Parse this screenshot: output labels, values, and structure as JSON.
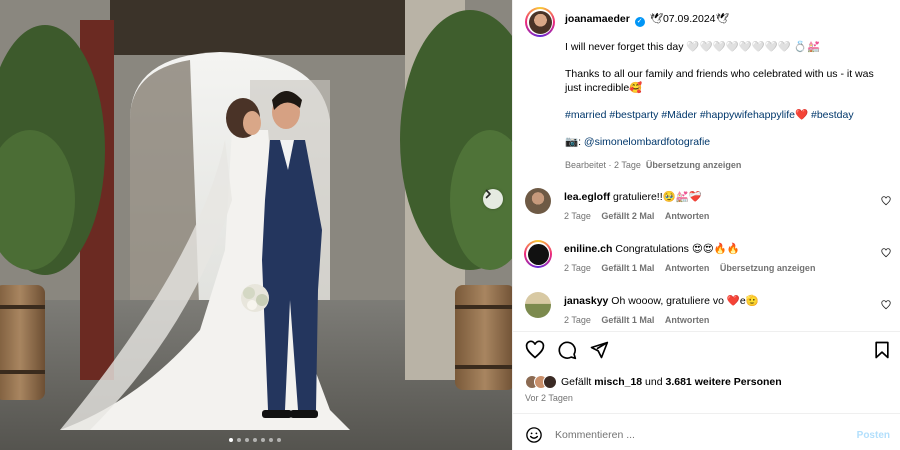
{
  "post": {
    "username": "joanamaeder",
    "date_text": "🕊07.09.2024🕊",
    "caption_line1": "I will never forget this day 🤍🤍🤍🤍🤍🤍🤍🤍 💍💒",
    "caption_line2": "Thanks to all our family and friends who celebrated with us - it was just incredible🥰",
    "hashtags": [
      "#married",
      "#bestparty",
      "#Mäder",
      "#happywifehappylife❤️",
      "#bestday"
    ],
    "photo_credit_icon": "📷:",
    "photo_credit": "@simonelombardfotografie",
    "meta_edited": "Bearbeitet · 2 Tage",
    "meta_translate": "Übersetzung anzeigen"
  },
  "comments": [
    {
      "username": "lea.egloff",
      "text": "gratuliere!!🥹💒❤️‍🩹",
      "time": "2 Tage",
      "likes": "Gefällt 2 Mal",
      "reply": "Antworten",
      "translate": ""
    },
    {
      "username": "eniline.ch",
      "text": "Congratulations 😍😍🔥🔥",
      "time": "2 Tage",
      "likes": "Gefällt 1 Mal",
      "reply": "Antworten",
      "translate": "Übersetzung anzeigen"
    },
    {
      "username": "janaskyy",
      "text": "Oh wooow, gratuliere vo ❤️e🫡",
      "time": "2 Tage",
      "likes": "Gefällt 1 Mal",
      "reply": "Antworten",
      "translate": ""
    }
  ],
  "likes": {
    "prefix": "Gefällt ",
    "user": "misch_18",
    "middle": " und ",
    "count": "3.681 weitere Personen"
  },
  "time_ago": "Vor 2 Tagen",
  "comment_box": {
    "placeholder": "Kommentieren ...",
    "post_label": "Posten"
  },
  "carousel": {
    "slides": 7,
    "active_index": 0
  },
  "icons": {
    "next": "chevron-right-icon",
    "like": "heart-icon",
    "comment": "comment-icon",
    "share": "share-icon",
    "save": "bookmark-icon",
    "emoji": "smiley-icon",
    "comment_like": "heart-icon",
    "verified": "verified-badge-icon"
  },
  "colors": {
    "link": "#00376b",
    "verified": "#0095f6",
    "meta": "#737373",
    "post_disabled": "#b2dffc"
  }
}
